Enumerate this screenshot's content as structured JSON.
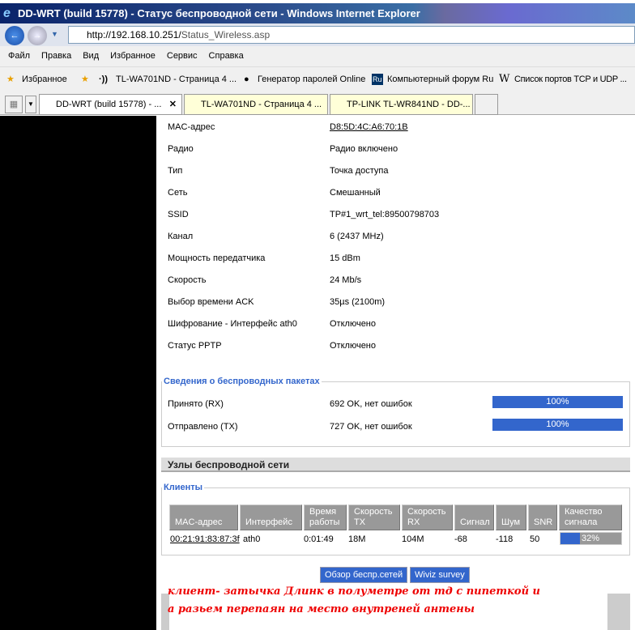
{
  "window": {
    "title": "DD-WRT (build 15778) - Статус беспроводной сети - Windows Internet Explorer"
  },
  "address": {
    "host": "http://192.168.10.251/",
    "path": "Status_Wireless.asp"
  },
  "menu": [
    "Файл",
    "Правка",
    "Вид",
    "Избранное",
    "Сервис",
    "Справка"
  ],
  "favorites": {
    "label": "Избранное",
    "items": [
      "TL-WA701ND - Страница 4 ...",
      "Генератор паролей Online",
      "Компьютерный форум Ru",
      "Список портов TCP и UDP ..."
    ]
  },
  "tabs": [
    "DD-WRT (build 15778) - ...",
    "TL-WA701ND - Страница 4 ...",
    "TP-LINK TL-WR841ND - DD-..."
  ],
  "wireless": [
    {
      "k": "MAC-адрес",
      "v": "D8:5D:4C:A6:70:1B"
    },
    {
      "k": "Радио",
      "v": "Радио включено"
    },
    {
      "k": "Тип",
      "v": "Точка доступа"
    },
    {
      "k": "Сеть",
      "v": "Смешанный"
    },
    {
      "k": "SSID",
      "v": "TP#1_wrt_tel:89500798703"
    },
    {
      "k": "Канал",
      "v": "6 (2437 MHz)"
    },
    {
      "k": "Мощность передатчика",
      "v": "15 dBm"
    },
    {
      "k": "Скорость",
      "v": "24 Mb/s"
    },
    {
      "k": "Выбор времени ACK",
      "v": "35µs (2100m)"
    },
    {
      "k": "Шифрование - Интерфейс ath0",
      "v": "Отключено"
    },
    {
      "k": "Статус PPTP",
      "v": "Отключено"
    }
  ],
  "packets": {
    "title": "Сведения о беспроводных пакетах",
    "rows": [
      {
        "k": "Принято (RX)",
        "v": "692 OK, нет ошибок",
        "pct": 100,
        "pct_label": "100%"
      },
      {
        "k": "Отправлено (TX)",
        "v": "727 OK, нет ошибок",
        "pct": 100,
        "pct_label": "100%"
      }
    ]
  },
  "nodes": {
    "title": "Узлы беспроводной сети",
    "clients_title": "Клиенты",
    "headers": [
      "MAC-адрес",
      "Интерфейс",
      "Время работы",
      "Скорость TX",
      "Скорость RX",
      "Сигнал",
      "Шум",
      "SNR",
      "Качество сигнала"
    ],
    "row": [
      "00:21:91:83:87:3f",
      "ath0",
      "0:01:49",
      "18M",
      "104M",
      "-68",
      "-118",
      "50"
    ],
    "quality": 32,
    "quality_label": "32%"
  },
  "buttons": {
    "survey": "Обзор беспр.сетей",
    "wiviz": "Wiviz survey"
  },
  "note": {
    "line1": "клиент- затычка Длинк в полуметре от тд с пипеткой и",
    "line2": "а разьем перепаян на место внутреней антены"
  }
}
